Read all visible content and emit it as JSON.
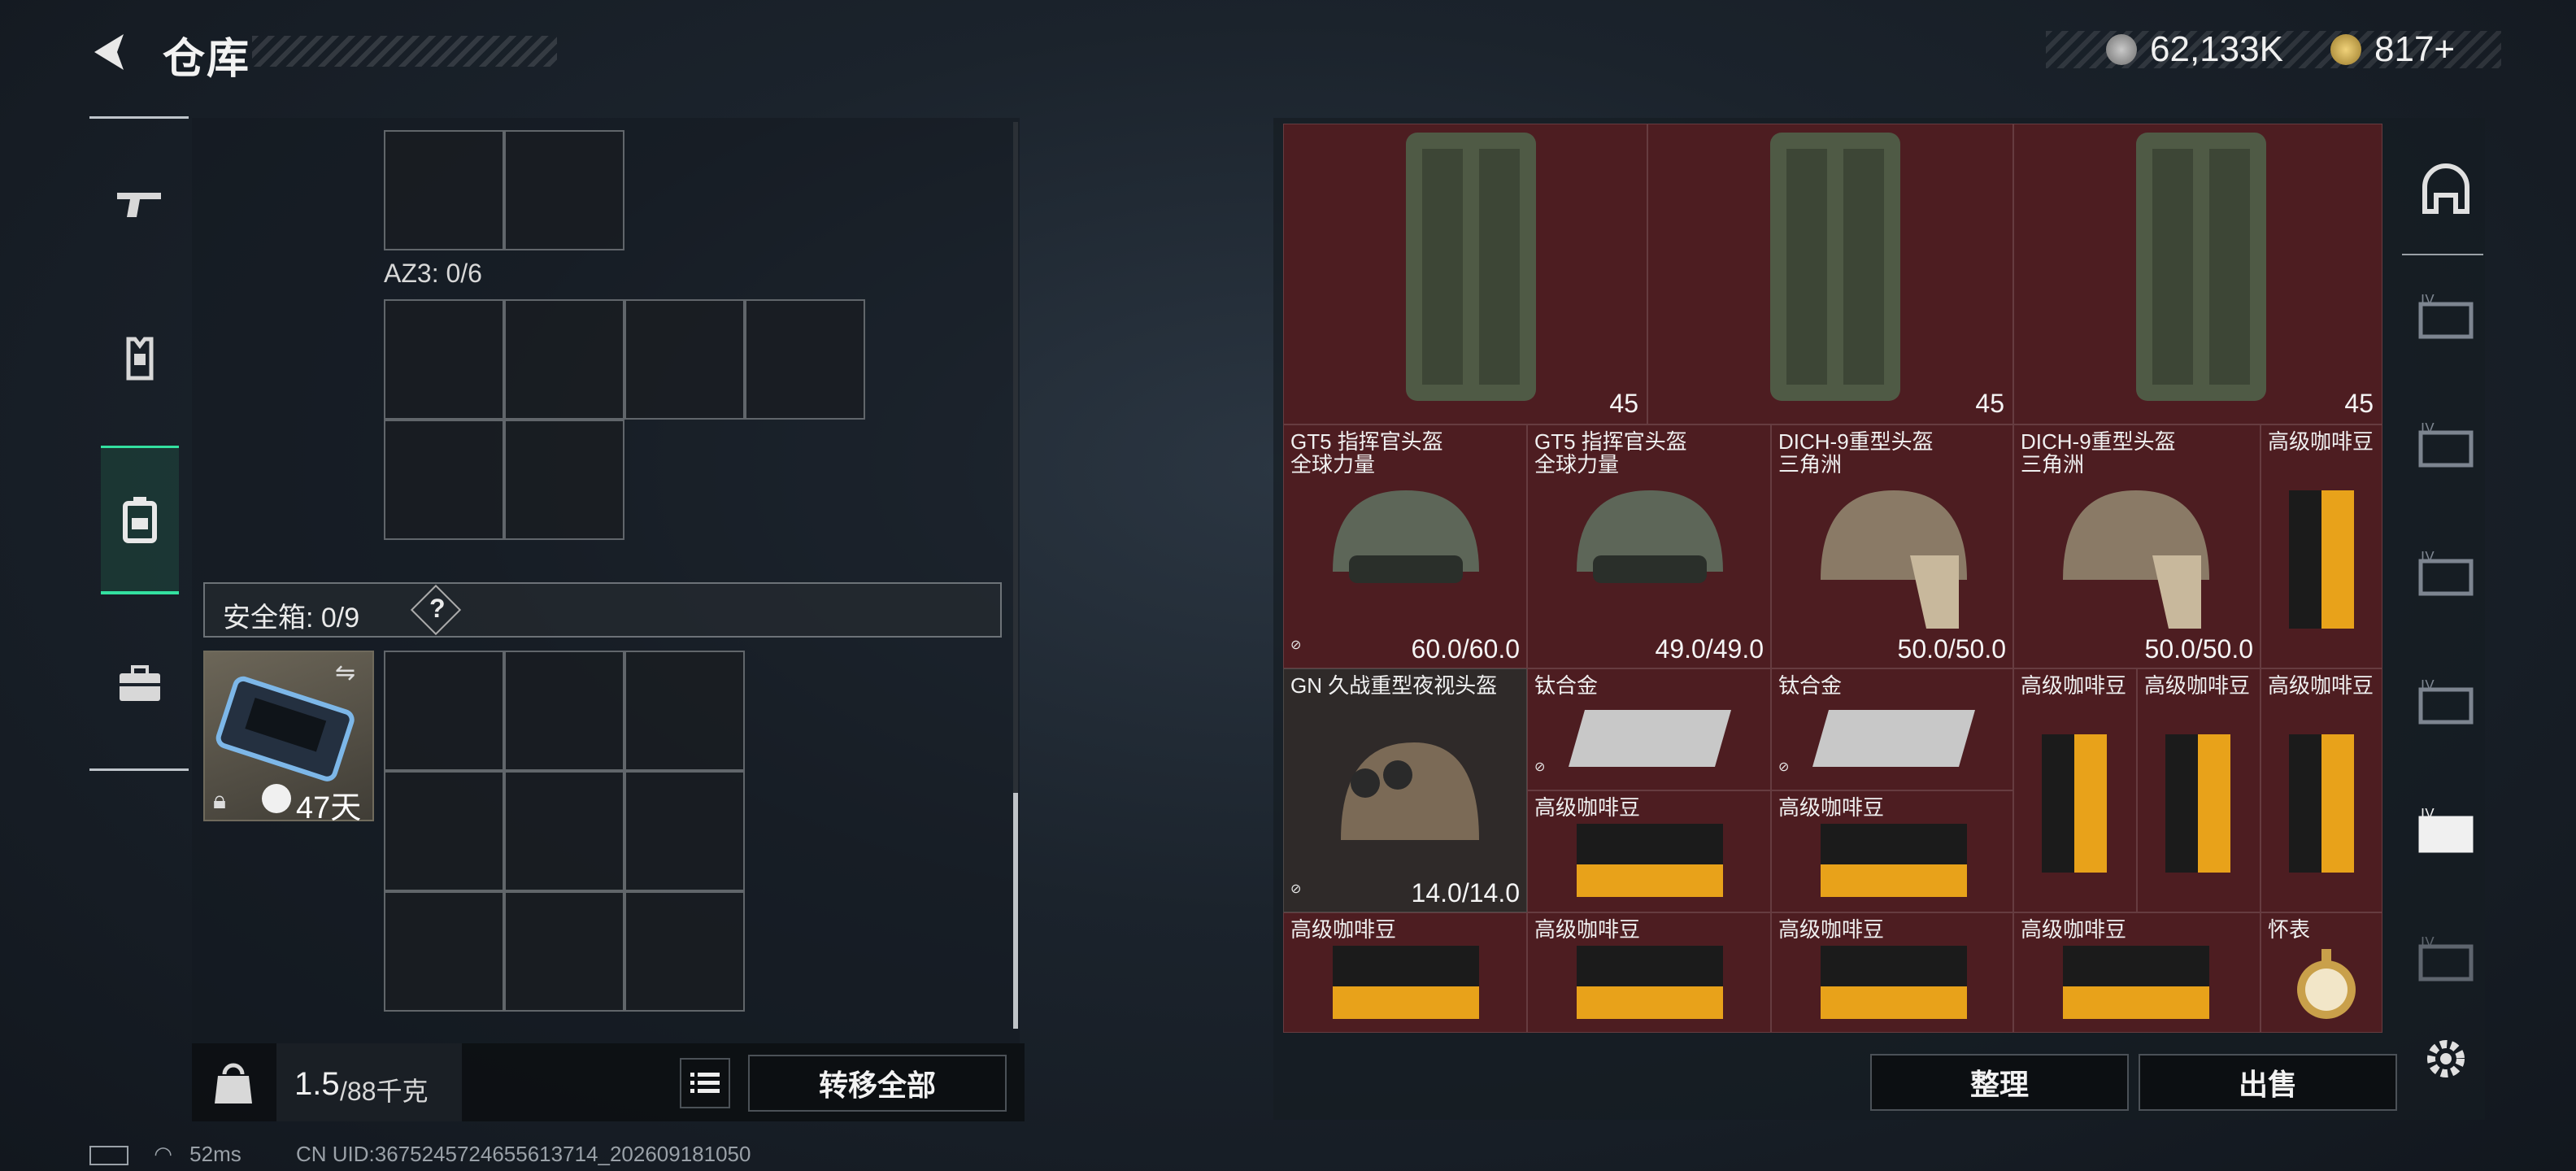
{
  "header": {
    "title": "仓库",
    "currency_1": "62,133K",
    "currency_2": "817+",
    "back_icon": "back-arrow-icon"
  },
  "left_nav": {
    "items": [
      {
        "icon": "gun-icon"
      },
      {
        "icon": "armor-vest-icon"
      },
      {
        "icon": "backpack-icon",
        "active": true
      },
      {
        "icon": "briefcase-icon"
      }
    ]
  },
  "left_panel": {
    "az3_label": "AZ3: 0/6",
    "safebox_label": "安全箱: 0/9",
    "safebox_help": "?",
    "safebox_item_days": "47天",
    "weight_value": "1.5",
    "weight_max": "/88千克",
    "transfer_all": "转移全部"
  },
  "inventory": {
    "row1": [
      {
        "qty": "45"
      },
      {
        "qty": "45"
      },
      {
        "qty": "45"
      }
    ],
    "helmets": [
      {
        "name": "GT5 指挥官头盔",
        "sub": "全球力量",
        "durability": "60.0/60.0",
        "nolink": true
      },
      {
        "name": "GT5 指挥官头盔",
        "sub": "全球力量",
        "durability": "49.0/49.0",
        "nolink": false
      },
      {
        "name": "DICH-9重型头盔",
        "sub": "三角洲",
        "durability": "50.0/50.0",
        "nolink": false
      },
      {
        "name": "DICH-9重型头盔",
        "sub": "三角洲",
        "durability": "50.0/50.0",
        "nolink": false
      }
    ],
    "coffee_label": "高级咖啡豆",
    "nv_helmet": {
      "name": "GN 久战重型夜视头盔",
      "durability": "14.0/14.0"
    },
    "titanium": "钛合金",
    "watch": "怀表",
    "sort_button": "整理",
    "sell_button": "出售"
  },
  "status_bar": {
    "ping": "52ms",
    "uid": "CN UID:3675245724655613714_202609181050"
  },
  "colors": {
    "accent": "#33e0a0",
    "inventory_bg": "#4d1d21"
  }
}
